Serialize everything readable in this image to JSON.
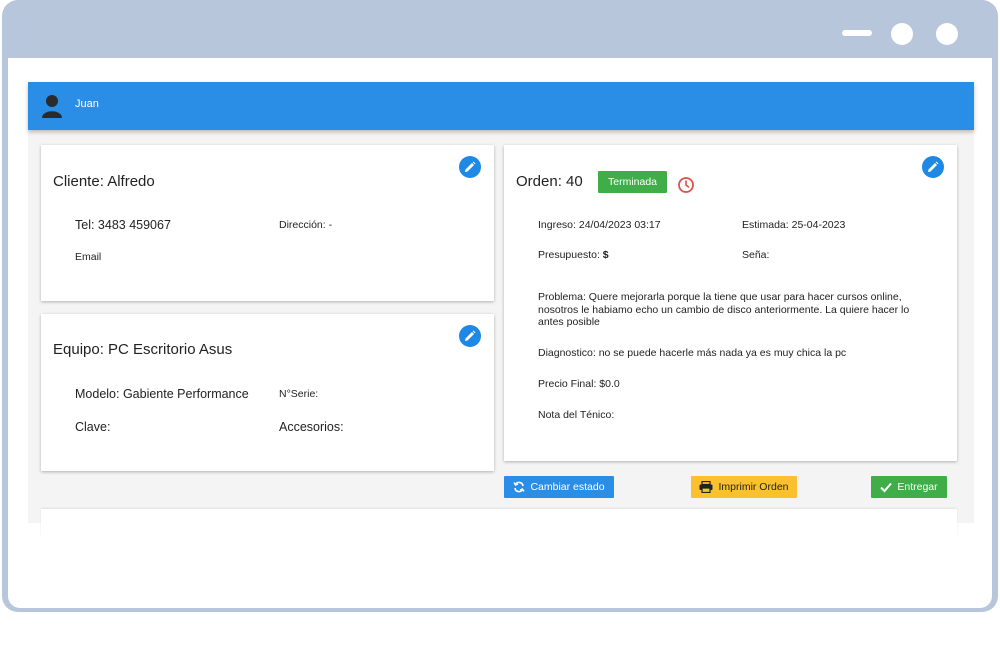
{
  "window": {
    "controls": [
      "minimize-icon",
      "maximize-icon",
      "close-icon"
    ]
  },
  "header": {
    "user_name": "Juan",
    "color": "#2a8ee6"
  },
  "cliente_card": {
    "title": "Cliente: Alfredo",
    "tel": "Tel: 3483 459067",
    "direccion": "Dirección: -",
    "email": "Email"
  },
  "equipo_card": {
    "title": "Equipo: PC Escritorio Asus",
    "modelo": "Modelo: Gabiente Performance",
    "serie": "N°Serie:",
    "clave": "Clave:",
    "accesorios": "Accesorios:"
  },
  "orden_card": {
    "title": "Orden: 40",
    "status": "Terminada",
    "status_color": "#3fae48",
    "ingreso": "Ingreso: 24/04/2023 03:17",
    "estimada": "Estimada: 25-04-2023",
    "presupuesto_label": "Presupuesto:",
    "presupuesto_value": "$",
    "sena": "Seña:",
    "problema": "Problema: Quere mejorarla porque la tiene que usar para hacer cursos online, nosotros le habiamo echo un cambio de disco anteriormente. La quiere hacer lo antes posible",
    "diagnostico": "Diagnostico: no se puede hacerle más nada ya es muy chica la pc",
    "precio_final": "Precio Final: $0.0",
    "nota_tecnico": "Nota del Ténico:"
  },
  "actions": {
    "cambiar_estado": "Cambiar estado",
    "imprimir_orden": "Imprimir Orden",
    "entregar": "Entregar"
  }
}
